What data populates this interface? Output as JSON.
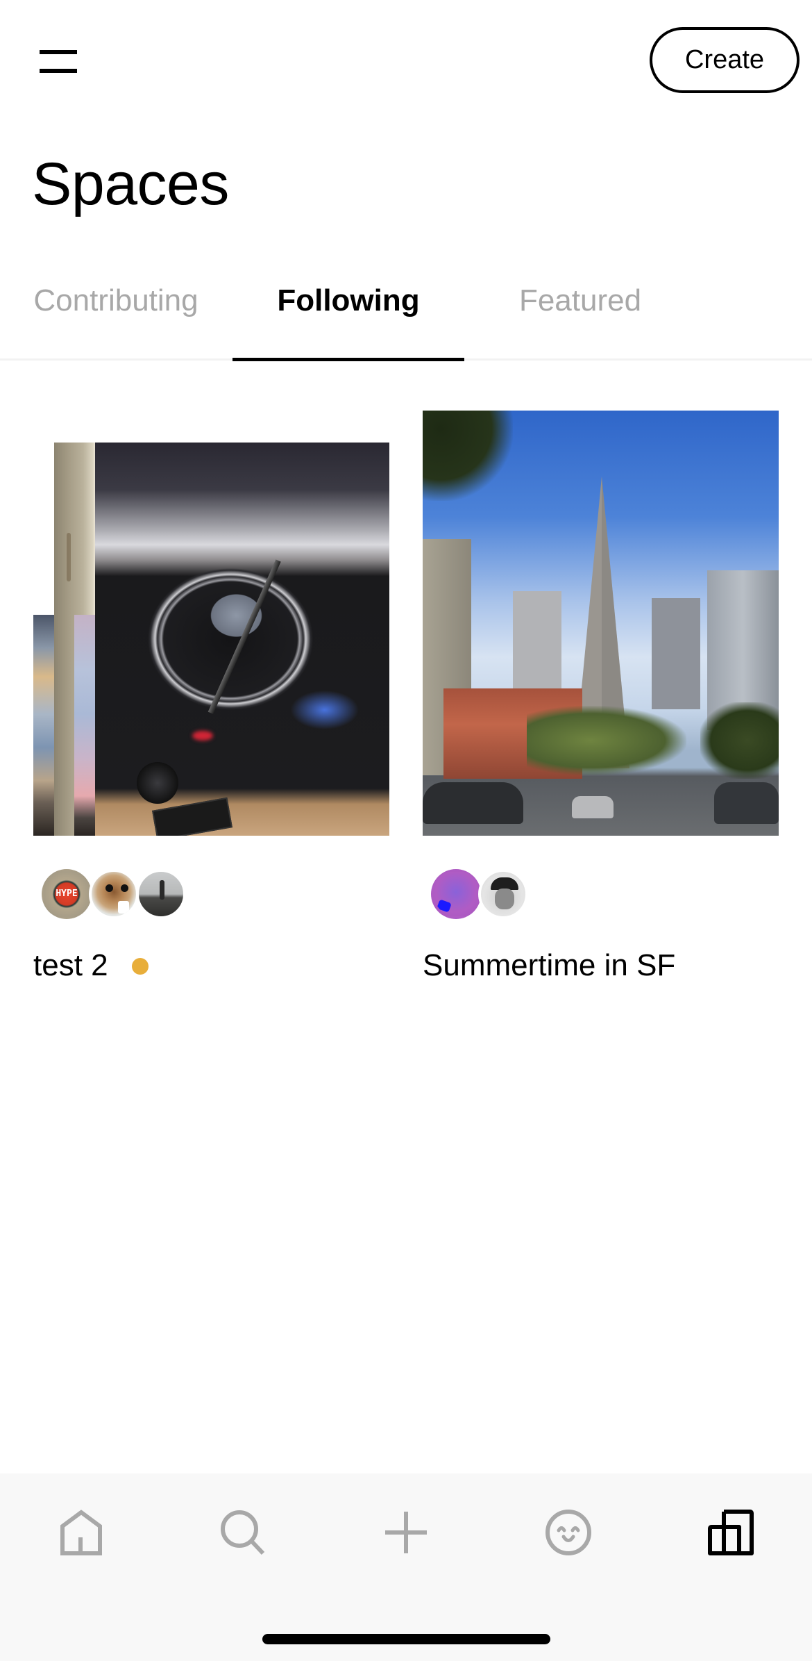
{
  "header": {
    "menu_icon": "hamburger-menu-icon",
    "create_label": "Create"
  },
  "page": {
    "title": "Spaces"
  },
  "tabs": [
    {
      "label": "Contributing",
      "active": false
    },
    {
      "label": "Following",
      "active": true
    },
    {
      "label": "Featured",
      "active": false
    }
  ],
  "spaces": [
    {
      "title": "test 2",
      "has_unread_dot": true,
      "dot_color": "#E8AE3A",
      "cover": "stacked photos: turntable with vinyl record, wall edge, sunset skies",
      "contributors": [
        {
          "avatar": "hype-button-photo"
        },
        {
          "avatar": "plush-dog-photo"
        },
        {
          "avatar": "person-on-rocks-photo"
        }
      ]
    },
    {
      "title": "Summertime in SF",
      "has_unread_dot": false,
      "cover": "Transamerica Pyramid street view, San Francisco",
      "contributors": [
        {
          "avatar": "purple-hand-photo"
        },
        {
          "avatar": "memoji-cap"
        }
      ]
    }
  ],
  "bottom_nav": [
    {
      "icon": "home-icon",
      "active": false
    },
    {
      "icon": "search-icon",
      "active": false
    },
    {
      "icon": "plus-icon",
      "active": false
    },
    {
      "icon": "smiley-icon",
      "active": false
    },
    {
      "icon": "spaces-icon",
      "active": true
    }
  ],
  "colors": {
    "active": "#000000",
    "inactive": "#A8A8A8",
    "nav_background": "#F8F8F8",
    "divider": "#F2F2F2"
  }
}
